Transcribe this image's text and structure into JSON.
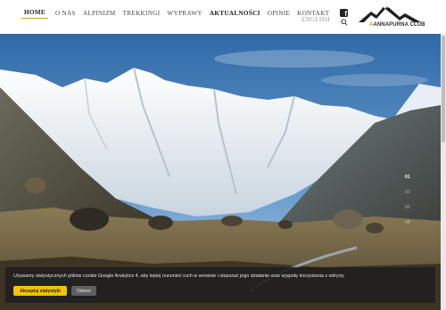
{
  "nav": {
    "items": [
      {
        "label": "HOME",
        "active": true
      },
      {
        "label": "O NAS"
      },
      {
        "label": "ALPINIZM"
      },
      {
        "label": "TREKKINGI"
      },
      {
        "label": "WYPRAWY"
      },
      {
        "label": "AKTUALNOŚCI",
        "bold": true
      },
      {
        "label": "OPINIE"
      },
      {
        "label": "KONTAKT"
      }
    ],
    "language": "ENGLISH"
  },
  "logo": {
    "text": "ANNAPURNA CLUB",
    "accent_color": "#c9a227"
  },
  "icons": [
    "facebook-icon",
    "search-icon",
    "mountain-logo-icon"
  ],
  "slider": {
    "pages": [
      "01",
      "02",
      "03",
      "04"
    ],
    "active_page": "01"
  },
  "cookie": {
    "text": "Używamy statystycznych plików cookie Google Analytics 4, aby lepiej rozumieć ruch w serwisie i ulepszać jego działanie oraz wygodę korzystania z witryny.",
    "accept_label": "Akceptuj statystyki",
    "reject_label": "Odrzuć",
    "accept_color": "#f2c400"
  }
}
